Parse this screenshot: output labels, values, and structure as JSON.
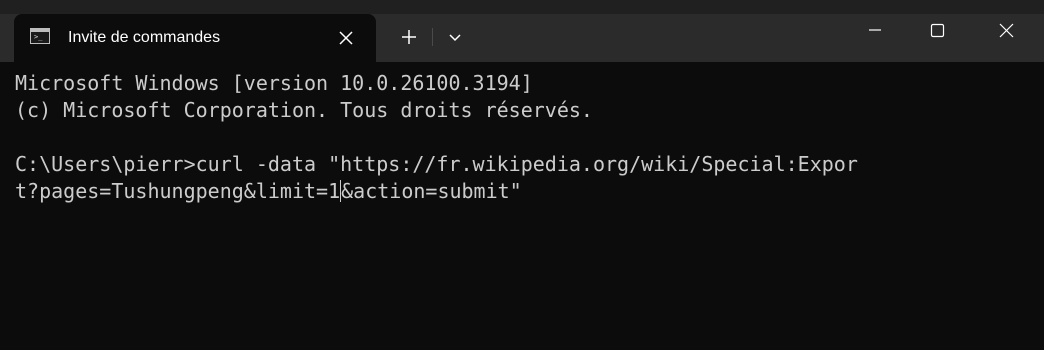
{
  "window": {
    "tab_title": "Invite de commandes"
  },
  "terminal": {
    "line1": "Microsoft Windows [version 10.0.26100.3194]",
    "line2": "(c) Microsoft Corporation. Tous droits réservés.",
    "line3": "",
    "prompt_line_part1": "C:\\Users\\pierr>curl -data \"https://fr.wikipedia.org/wiki/Special:Expor",
    "prompt_line_part2_before_cursor": "t?pages=Tushungpeng&limit=1",
    "prompt_line_part2_after_cursor": "&action=submit\""
  },
  "icons": {
    "tab_icon": "cmd-icon",
    "tab_close": "close-icon",
    "new_tab": "plus-icon",
    "dropdown": "chevron-down-icon",
    "minimize": "minimize-icon",
    "maximize": "maximize-icon",
    "close_window": "close-icon"
  },
  "colors": {
    "terminal_bg": "#0c0c0c",
    "terminal_fg": "#cccccc",
    "titlebar_bg": "#2b2b2b"
  }
}
